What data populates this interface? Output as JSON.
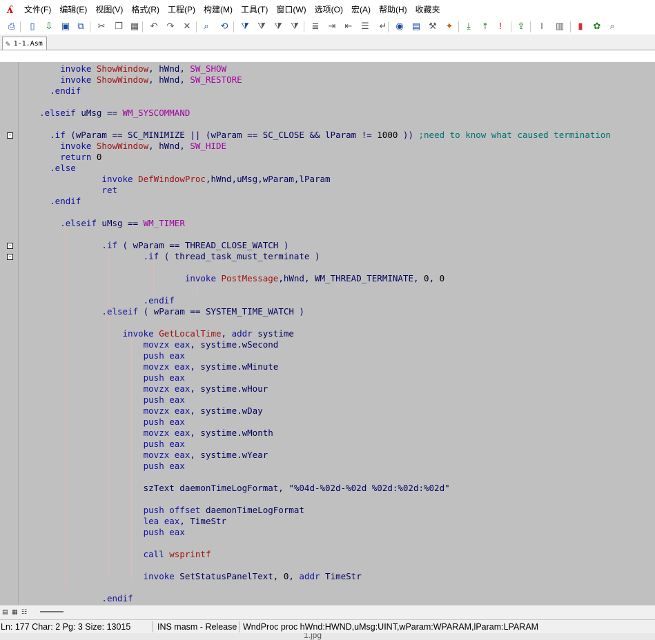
{
  "menubar": {
    "items": [
      "文件(F)",
      "编辑(E)",
      "视图(V)",
      "格式(R)",
      "工程(P)",
      "构建(M)",
      "工具(T)",
      "窗口(W)",
      "选项(O)",
      "宏(A)",
      "帮助(H)",
      "收藏夹"
    ]
  },
  "toolbar": {
    "icons": [
      "print-icon",
      "new-file-icon",
      "open-file-icon",
      "save-icon",
      "save-all-icon",
      "cut-icon",
      "copy-icon",
      "paste-icon",
      "undo-icon",
      "redo-icon",
      "delete-icon",
      "find-icon",
      "replace-icon",
      "filter-icon",
      "filter-next-icon",
      "filter-prev-icon",
      "filter-clear-icon",
      "format-icon",
      "indent-icon",
      "outdent-icon",
      "list-icon",
      "wrap-icon",
      "browser-icon",
      "window-icon",
      "tools-icon",
      "build-icon",
      "download-icon",
      "upload-icon",
      "exclamation-icon",
      "export-icon",
      "cursor-icon",
      "document-icon",
      "color-bars-icon",
      "palette-icon",
      "zoom-icon"
    ]
  },
  "tabs": [
    {
      "label": "1-1.Asm"
    }
  ],
  "editor": {
    "lines": [
      [
        [
          "        ",
          "plain"
        ],
        [
          "invoke",
          "kw"
        ],
        [
          " ",
          "plain"
        ],
        [
          "ShowWindow",
          "fn"
        ],
        [
          ", hWnd, ",
          "plain"
        ],
        [
          "SW_SHOW",
          "cst"
        ]
      ],
      [
        [
          "        ",
          "plain"
        ],
        [
          "invoke",
          "kw"
        ],
        [
          " ",
          "plain"
        ],
        [
          "ShowWindow",
          "fn"
        ],
        [
          ", hWnd, ",
          "plain"
        ],
        [
          "SW_RESTORE",
          "cst"
        ]
      ],
      [
        [
          "      ",
          "plain"
        ],
        [
          ".endif",
          "kw"
        ]
      ],
      [
        [
          "",
          "plain"
        ]
      ],
      [
        [
          "    ",
          "plain"
        ],
        [
          ".elseif",
          "kw"
        ],
        [
          " uMsg == ",
          "plain"
        ],
        [
          "WM_SYSCOMMAND",
          "cst"
        ]
      ],
      [
        [
          "",
          "plain"
        ]
      ],
      [
        [
          "      ",
          "plain"
        ],
        [
          ".if",
          "kw"
        ],
        [
          " (wParam == SC_MINIMIZE || (wParam == SC_CLOSE && lParam != ",
          "plain"
        ],
        [
          "1000",
          "num"
        ],
        [
          " )) ",
          "plain"
        ],
        [
          ";need to know what caused termination",
          "cmt"
        ]
      ],
      [
        [
          "        ",
          "plain"
        ],
        [
          "invoke",
          "kw"
        ],
        [
          " ",
          "plain"
        ],
        [
          "ShowWindow",
          "fn"
        ],
        [
          ", hWnd, ",
          "plain"
        ],
        [
          "SW_HIDE",
          "cst"
        ]
      ],
      [
        [
          "        ",
          "plain"
        ],
        [
          "return",
          "kw"
        ],
        [
          " ",
          "plain"
        ],
        [
          "0",
          "num"
        ]
      ],
      [
        [
          "      ",
          "plain"
        ],
        [
          ".else",
          "kw"
        ]
      ],
      [
        [
          "                ",
          "plain"
        ],
        [
          "invoke",
          "kw"
        ],
        [
          " ",
          "plain"
        ],
        [
          "DefWindowProc",
          "fn"
        ],
        [
          ",hWnd,uMsg,wParam,lParam",
          "plain"
        ]
      ],
      [
        [
          "                ",
          "plain"
        ],
        [
          "ret",
          "kw"
        ]
      ],
      [
        [
          "      ",
          "plain"
        ],
        [
          ".endif",
          "kw"
        ]
      ],
      [
        [
          "",
          "plain"
        ]
      ],
      [
        [
          "        ",
          "plain"
        ],
        [
          ".elseif",
          "kw"
        ],
        [
          " uMsg == ",
          "plain"
        ],
        [
          "WM_TIMER",
          "cst"
        ]
      ],
      [
        [
          "",
          "plain"
        ]
      ],
      [
        [
          "                ",
          "plain"
        ],
        [
          ".if",
          "kw"
        ],
        [
          " ( wParam == THREAD_CLOSE_WATCH )",
          "plain"
        ]
      ],
      [
        [
          "                        ",
          "plain"
        ],
        [
          ".if",
          "kw"
        ],
        [
          " ( thread_task_must_terminate )",
          "plain"
        ]
      ],
      [
        [
          "",
          "plain"
        ]
      ],
      [
        [
          "                                ",
          "plain"
        ],
        [
          "invoke",
          "kw"
        ],
        [
          " ",
          "plain"
        ],
        [
          "PostMessage",
          "fn"
        ],
        [
          ",hWnd, WM_THREAD_TERMINATE, ",
          "plain"
        ],
        [
          "0",
          "num"
        ],
        [
          ", ",
          "plain"
        ],
        [
          "0",
          "num"
        ]
      ],
      [
        [
          "",
          "plain"
        ]
      ],
      [
        [
          "                        ",
          "plain"
        ],
        [
          ".endif",
          "kw"
        ]
      ],
      [
        [
          "                ",
          "plain"
        ],
        [
          ".elseif",
          "kw"
        ],
        [
          " ( wParam == SYSTEM_TIME_WATCH )",
          "plain"
        ]
      ],
      [
        [
          "",
          "plain"
        ]
      ],
      [
        [
          "                    ",
          "plain"
        ],
        [
          "invoke",
          "kw"
        ],
        [
          " ",
          "plain"
        ],
        [
          "GetLocalTime",
          "fn"
        ],
        [
          ", ",
          "plain"
        ],
        [
          "addr",
          "kw"
        ],
        [
          " systime",
          "plain"
        ]
      ],
      [
        [
          "                        ",
          "plain"
        ],
        [
          "movzx",
          "kw"
        ],
        [
          " ",
          "plain"
        ],
        [
          "eax",
          "kw"
        ],
        [
          ", systime.wSecond",
          "plain"
        ]
      ],
      [
        [
          "                        ",
          "plain"
        ],
        [
          "push",
          "kw"
        ],
        [
          " ",
          "plain"
        ],
        [
          "eax",
          "kw"
        ]
      ],
      [
        [
          "                        ",
          "plain"
        ],
        [
          "movzx",
          "kw"
        ],
        [
          " ",
          "plain"
        ],
        [
          "eax",
          "kw"
        ],
        [
          ", systime.wMinute",
          "plain"
        ]
      ],
      [
        [
          "                        ",
          "plain"
        ],
        [
          "push",
          "kw"
        ],
        [
          " ",
          "plain"
        ],
        [
          "eax",
          "kw"
        ]
      ],
      [
        [
          "                        ",
          "plain"
        ],
        [
          "movzx",
          "kw"
        ],
        [
          " ",
          "plain"
        ],
        [
          "eax",
          "kw"
        ],
        [
          ", systime.wHour",
          "plain"
        ]
      ],
      [
        [
          "                        ",
          "plain"
        ],
        [
          "push",
          "kw"
        ],
        [
          " ",
          "plain"
        ],
        [
          "eax",
          "kw"
        ]
      ],
      [
        [
          "                        ",
          "plain"
        ],
        [
          "movzx",
          "kw"
        ],
        [
          " ",
          "plain"
        ],
        [
          "eax",
          "kw"
        ],
        [
          ", systime.wDay",
          "plain"
        ]
      ],
      [
        [
          "                        ",
          "plain"
        ],
        [
          "push",
          "kw"
        ],
        [
          " ",
          "plain"
        ],
        [
          "eax",
          "kw"
        ]
      ],
      [
        [
          "                        ",
          "plain"
        ],
        [
          "movzx",
          "kw"
        ],
        [
          " ",
          "plain"
        ],
        [
          "eax",
          "kw"
        ],
        [
          ", systime.wMonth",
          "plain"
        ]
      ],
      [
        [
          "                        ",
          "plain"
        ],
        [
          "push",
          "kw"
        ],
        [
          " ",
          "plain"
        ],
        [
          "eax",
          "kw"
        ]
      ],
      [
        [
          "                        ",
          "plain"
        ],
        [
          "movzx",
          "kw"
        ],
        [
          " ",
          "plain"
        ],
        [
          "eax",
          "kw"
        ],
        [
          ", systime.wYear",
          "plain"
        ]
      ],
      [
        [
          "                        ",
          "plain"
        ],
        [
          "push",
          "kw"
        ],
        [
          " ",
          "plain"
        ],
        [
          "eax",
          "kw"
        ]
      ],
      [
        [
          "",
          "plain"
        ]
      ],
      [
        [
          "                        ",
          "plain"
        ],
        [
          "szText daemonTimeLogFormat, \"%04d-%02d-%02d %02d:%02d:%02d\"",
          "plain"
        ]
      ],
      [
        [
          "",
          "plain"
        ]
      ],
      [
        [
          "                        ",
          "plain"
        ],
        [
          "push",
          "kw"
        ],
        [
          " ",
          "plain"
        ],
        [
          "offset",
          "kw"
        ],
        [
          " daemonTimeLogFormat",
          "plain"
        ]
      ],
      [
        [
          "                        ",
          "plain"
        ],
        [
          "lea",
          "kw"
        ],
        [
          " ",
          "plain"
        ],
        [
          "eax",
          "kw"
        ],
        [
          ", TimeStr",
          "plain"
        ]
      ],
      [
        [
          "                        ",
          "plain"
        ],
        [
          "push",
          "kw"
        ],
        [
          " ",
          "plain"
        ],
        [
          "eax",
          "kw"
        ]
      ],
      [
        [
          "",
          "plain"
        ]
      ],
      [
        [
          "                        ",
          "plain"
        ],
        [
          "call",
          "kw"
        ],
        [
          " ",
          "plain"
        ],
        [
          "wsprintf",
          "fn"
        ]
      ],
      [
        [
          "",
          "plain"
        ]
      ],
      [
        [
          "                        ",
          "plain"
        ],
        [
          "invoke",
          "kw"
        ],
        [
          " SetStatusPanelText, ",
          "plain"
        ],
        [
          "0",
          "num"
        ],
        [
          ", ",
          "plain"
        ],
        [
          "addr",
          "kw"
        ],
        [
          " TimeStr",
          "plain"
        ]
      ],
      [
        [
          "",
          "plain"
        ]
      ],
      [
        [
          "                ",
          "plain"
        ],
        [
          ".endif",
          "kw"
        ]
      ]
    ],
    "fold_markers": [
      "-",
      "-",
      "-"
    ]
  },
  "status": {
    "position": "Ln: 177 Char: 2 Pg: 3 Size: 13015",
    "mode": "INS masm - Release",
    "context": "WndProc proc hWnd:HWND,uMsg:UINT,wParam:WPARAM,lParam:LPARAM"
  },
  "taskbar_peek": "1.jpg",
  "colors": {
    "editor_bg": "#c0c0c0",
    "keyword": "#1010a0",
    "function": "#a01010",
    "constant": "#a000a0",
    "comment": "#007070"
  }
}
